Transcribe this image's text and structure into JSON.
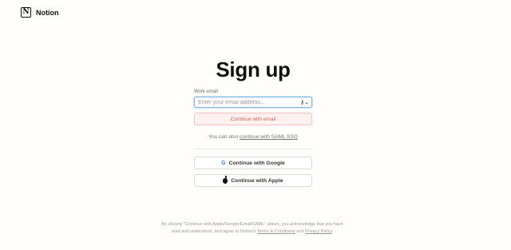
{
  "header": {
    "logo_letter": "N",
    "brand": "Notion"
  },
  "signup": {
    "title": "Sign up",
    "email_label": "Work email",
    "email_placeholder": "Enter your email address...",
    "email_value": "",
    "continue_email": "Continue with email",
    "sso_prefix": "You can also",
    "sso_link": "continue with SAML SSO",
    "google_label": "Continue with Google",
    "apple_label": "Continue with Apple"
  },
  "legal": {
    "part1": "By clicking “Continue with Apple/Google/Email/SAML” above, you acknowledge that you have read and understood, and agree to Notion's",
    "terms_link": "Terms & Conditions",
    "and": "and",
    "privacy_link": "Privacy Policy",
    "end": "."
  },
  "colors": {
    "accent_blue": "#8bb7e6",
    "primary_button_bg": "#fdf1ef",
    "primary_button_text": "#e16259",
    "google_blue": "#4285f4"
  },
  "icons": {
    "logo": "notion-logo-icon",
    "key": "key-icon",
    "google": "google-icon",
    "apple": "apple-icon"
  }
}
